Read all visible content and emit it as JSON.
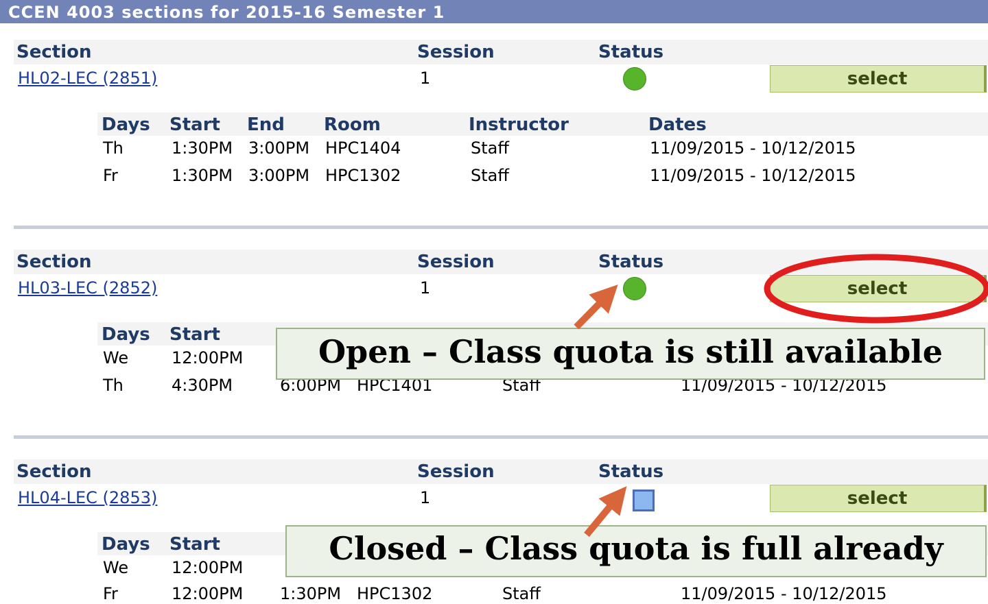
{
  "page_title": "CCEN 4003 sections for 2015-16 Semester 1",
  "labels": {
    "section": "Section",
    "session": "Session",
    "status": "Status",
    "select": "select",
    "days": "Days",
    "start": "Start",
    "end": "End",
    "room": "Room",
    "instructor": "Instructor",
    "dates": "Dates"
  },
  "sections": [
    {
      "id": "HL02-LEC (2851)",
      "session": "1",
      "status": "open",
      "meetings": [
        {
          "days": "Th",
          "start": "1:30PM",
          "end": "3:00PM",
          "room": "HPC1404",
          "instructor": "Staff",
          "dates": "11/09/2015 - 10/12/2015"
        },
        {
          "days": "Fr",
          "start": "1:30PM",
          "end": "3:00PM",
          "room": "HPC1302",
          "instructor": "Staff",
          "dates": "11/09/2015 - 10/12/2015"
        }
      ]
    },
    {
      "id": "HL03-LEC (2852)",
      "session": "1",
      "status": "open",
      "meetings": [
        {
          "days": "We",
          "start": "12:00PM"
        },
        {
          "days": "Th",
          "start": "4:30PM",
          "end": "6:00PM",
          "room": "HPC1401",
          "instructor": "Staff",
          "dates": "11/09/2015 - 10/12/2015"
        }
      ]
    },
    {
      "id": "HL04-LEC (2853)",
      "session": "1",
      "status": "closed",
      "meetings": [
        {
          "days": "We",
          "start": "12:00PM"
        },
        {
          "days": "Fr",
          "start": "12:00PM",
          "end": "1:30PM",
          "room": "HPC1302",
          "instructor": "Staff",
          "dates": "11/09/2015 - 10/12/2015"
        }
      ]
    }
  ],
  "callouts": {
    "open": "Open – Class quota is still available",
    "closed": "Closed – Class quota is full already"
  },
  "colors": {
    "title_bar": "#7283b7",
    "open_status": "#58b42b",
    "closed_status": "#8db8ef",
    "select_button": "#dbe9b0",
    "highlight_ring": "#e01e1e",
    "arrow": "#d9653b"
  }
}
